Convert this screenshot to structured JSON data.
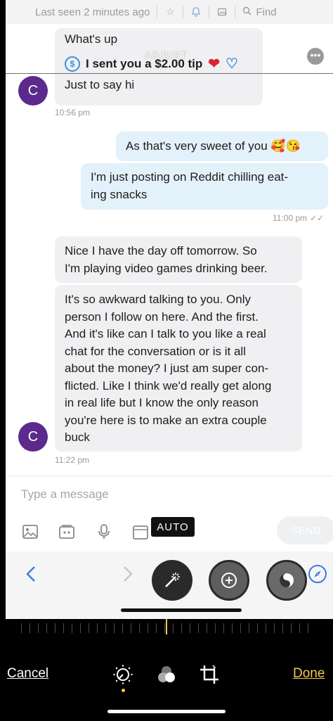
{
  "topbar": {
    "status": "Last seen 2 minutes ago",
    "find_label": "Find",
    "icons": [
      "star-icon",
      "bell-icon",
      "image-icon",
      "search-icon"
    ]
  },
  "editor_overlay": {
    "adjust_label": "ADJUST",
    "auto_label": "AUTO"
  },
  "chat": {
    "avatar_initial": "C",
    "msg1": "What's up",
    "tip": "I sent you a $2.00 tip",
    "msg2": "Just to say hi",
    "time1": "10:56 pm",
    "sent1": "As that's very sweet of you 🥰😘",
    "sent2_line1": "I'm just posting on Reddit chilling eat-",
    "sent2_line2": "ing snacks",
    "time2": "11:00 pm",
    "recv3_line1": "Nice I have the day off tomorrow. So",
    "recv3_line2": "I'm playing video games drinking beer.",
    "recv4_lines": [
      "It's so awkward talking to you. Only",
      "person I follow on here. And the first.",
      "And it's like can I talk to you like a real",
      "chat for the conversation or is it all",
      "about the money? I just am super con-",
      "flicted. Like I think we'd really get along",
      "in real life but I know the only reason",
      "you're here is to make an extra couple",
      "buck"
    ],
    "time3": "11:22 pm"
  },
  "composer": {
    "placeholder": "Type a message",
    "send_label": "SEND"
  },
  "editor": {
    "cancel_label": "Cancel",
    "done_label": "Done"
  },
  "colors": {
    "accent_blue": "#3a7ae0",
    "done_yellow": "#f2c94c",
    "avatar_purple": "#5b2a8c"
  }
}
